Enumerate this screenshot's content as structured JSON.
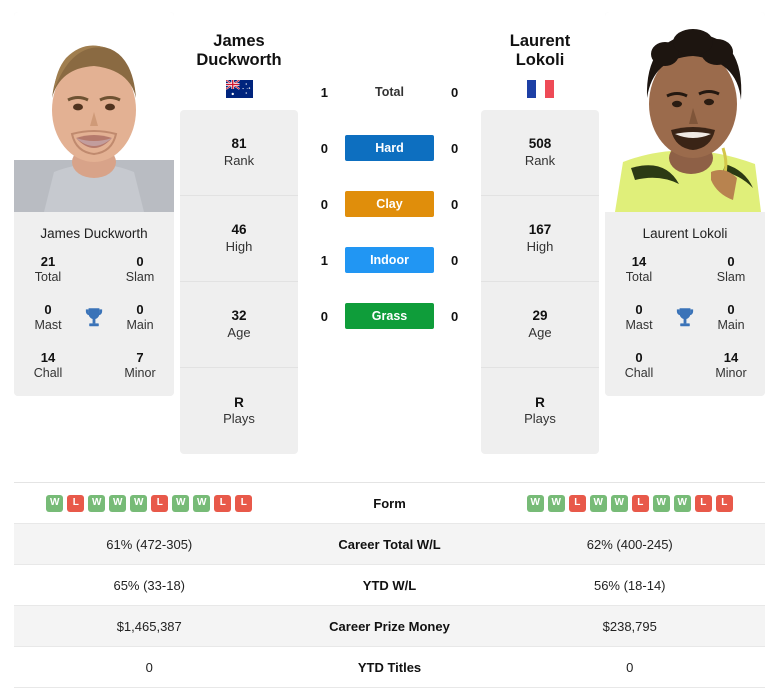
{
  "colors": {
    "hard": "#0d6fc0",
    "clay": "#e08e0b",
    "indoor": "#2196f3",
    "grass": "#0f9d3a",
    "win": "#77bb77",
    "loss": "#e8594a",
    "trophy": "#3a73b8",
    "card_bg": "#efefef",
    "alt_row": "#f4f4f4"
  },
  "players": {
    "left": {
      "name_line1": "James",
      "name_line2": "Duckworth",
      "full_name": "James Duckworth",
      "flag": "australia-flag",
      "rank_boxes": [
        {
          "value": "81",
          "label": "Rank"
        },
        {
          "value": "46",
          "label": "High"
        },
        {
          "value": "32",
          "label": "Age"
        },
        {
          "value": "R",
          "label": "Plays"
        }
      ],
      "titles": {
        "total_value": "21",
        "total_label": "Total",
        "slam_value": "0",
        "slam_label": "Slam",
        "mast_value": "0",
        "mast_label": "Mast",
        "main_value": "0",
        "main_label": "Main",
        "chall_value": "14",
        "chall_label": "Chall",
        "minor_value": "7",
        "minor_label": "Minor"
      },
      "form": [
        "W",
        "L",
        "W",
        "W",
        "W",
        "L",
        "W",
        "W",
        "L",
        "L"
      ],
      "career_wl": "61% (472-305)",
      "ytd_wl": "65% (33-18)",
      "career_prize": "$1,465,387",
      "ytd_titles": "0"
    },
    "right": {
      "name_line1": "Laurent",
      "name_line2": "Lokoli",
      "full_name": "Laurent Lokoli",
      "flag": "france-flag",
      "rank_boxes": [
        {
          "value": "508",
          "label": "Rank"
        },
        {
          "value": "167",
          "label": "High"
        },
        {
          "value": "29",
          "label": "Age"
        },
        {
          "value": "R",
          "label": "Plays"
        }
      ],
      "titles": {
        "total_value": "14",
        "total_label": "Total",
        "slam_value": "0",
        "slam_label": "Slam",
        "mast_value": "0",
        "mast_label": "Mast",
        "main_value": "0",
        "main_label": "Main",
        "chall_value": "0",
        "chall_label": "Chall",
        "minor_value": "14",
        "minor_label": "Minor"
      },
      "form": [
        "W",
        "W",
        "L",
        "W",
        "W",
        "L",
        "W",
        "W",
        "L",
        "L"
      ],
      "career_wl": "62% (400-245)",
      "ytd_wl": "56% (18-14)",
      "career_prize": "$238,795",
      "ytd_titles": "0"
    }
  },
  "head_to_head": [
    {
      "label": "Total",
      "left": "1",
      "right": "0",
      "badge": false,
      "color_key": ""
    },
    {
      "label": "Hard",
      "left": "0",
      "right": "0",
      "badge": true,
      "color_key": "hard"
    },
    {
      "label": "Clay",
      "left": "0",
      "right": "0",
      "badge": true,
      "color_key": "clay"
    },
    {
      "label": "Indoor",
      "left": "1",
      "right": "0",
      "badge": true,
      "color_key": "indoor"
    },
    {
      "label": "Grass",
      "left": "0",
      "right": "0",
      "badge": true,
      "color_key": "grass"
    }
  ],
  "table": {
    "rows": [
      {
        "label": "Form",
        "left": "",
        "right": "",
        "type": "form"
      },
      {
        "label": "Career Total W/L",
        "left": "61% (472-305)",
        "right": "62% (400-245)",
        "type": "text"
      },
      {
        "label": "YTD W/L",
        "left": "65% (33-18)",
        "right": "56% (18-14)",
        "type": "text"
      },
      {
        "label": "Career Prize Money",
        "left": "$1,465,387",
        "right": "$238,795",
        "type": "text"
      },
      {
        "label": "YTD Titles",
        "left": "0",
        "right": "0",
        "type": "text"
      }
    ]
  }
}
